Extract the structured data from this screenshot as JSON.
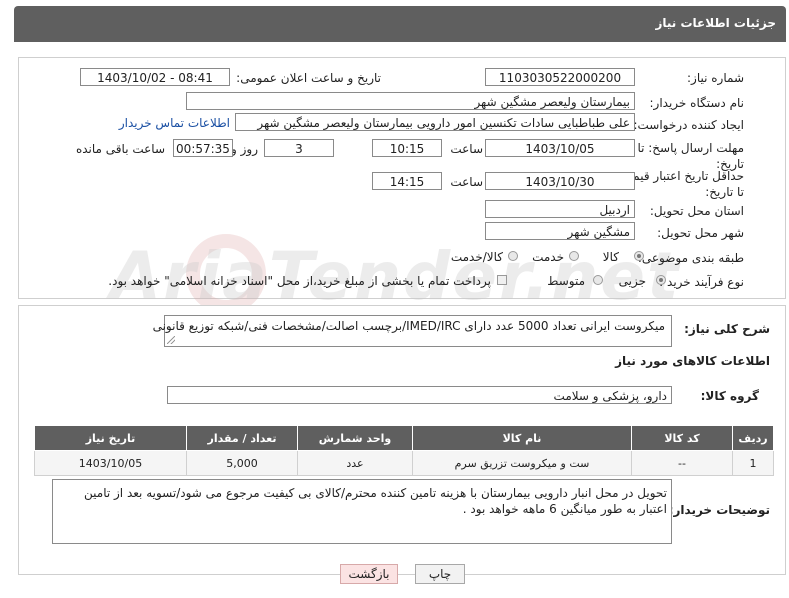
{
  "header": {
    "title": "جزئیات اطلاعات نیاز"
  },
  "form": {
    "need_number_label": "شماره نیاز:",
    "need_number": "1103030522000200",
    "announce_label": "تاریخ و ساعت اعلان عمومی:",
    "announce_value": "1403/10/02 - 08:41",
    "buyer_org_label": "نام دستگاه خریدار:",
    "buyer_org": "بیمارستان ولیعصر مشگین شهر",
    "requester_label": "ایجاد کننده درخواست:",
    "requester": "علی طباطبایی سادات تکنسین امور دارویی بیمارستان ولیعصر مشگین شهر",
    "contact_link": "اطلاعات تماس خریدار",
    "deadline_label": "مهلت ارسال پاسخ: تا تاریخ:",
    "deadline_date": "1403/10/05",
    "time_label": "ساعت",
    "deadline_time": "10:15",
    "days_count": "3",
    "days_label": "روز و",
    "remaining_time": "00:57:35",
    "remaining_label": "ساعت باقی مانده",
    "validity_label": "حداقل تاریخ اعتبار قیمت: تا تاریخ:",
    "validity_date": "1403/10/30",
    "validity_time": "14:15",
    "province_label": "استان محل تحویل:",
    "province": "اردبیل",
    "city_label": "شهر محل تحویل:",
    "city": "مشگین شهر",
    "category_label": "طبقه بندی موضوعی:",
    "category_options": [
      "کالا",
      "خدمت",
      "کالا/خدمت"
    ],
    "purchase_label": "نوع فرآیند خرید :",
    "purchase_options": [
      "جزیی",
      "متوسط"
    ],
    "payment_note": "پرداخت تمام یا بخشی از مبلغ خرید،از محل \"اسناد خزانه اسلامی\" خواهد بود."
  },
  "description": {
    "label": "شرح کلی نیاز:",
    "text": "میکروست ایرانی تعداد 5000 عدد دارای IMED/IRC/برچسب اصالت/مشخصات فنی/شبکه توزیع قانونی"
  },
  "goods": {
    "section_title": "اطلاعات کالاهای مورد نیاز",
    "group_label": "گروه کالا:",
    "group_value": "دارو، پزشکی و سلامت",
    "columns": [
      "ردیف",
      "کد کالا",
      "نام کالا",
      "واحد شمارش",
      "تعداد / مقدار",
      "تاریخ نیاز"
    ],
    "rows": [
      [
        "1",
        "--",
        "ست و میکروست تزریق سرم",
        "عدد",
        "5,000",
        "1403/10/05"
      ]
    ]
  },
  "buyer_notes": {
    "label": "توضیحات خریدار:",
    "text": "تحویل در محل انبار دارویی بیمارستان با هزینه تامین کننده محترم/کالای بی کیفیت مرجوع می شود/تسویه بعد از تامین اعتبار به طور میانگین 6 ماهه خواهد بود ."
  },
  "buttons": {
    "print": "چاپ",
    "back": "بازگشت"
  },
  "watermark": {
    "text": "AriaTender.net"
  }
}
